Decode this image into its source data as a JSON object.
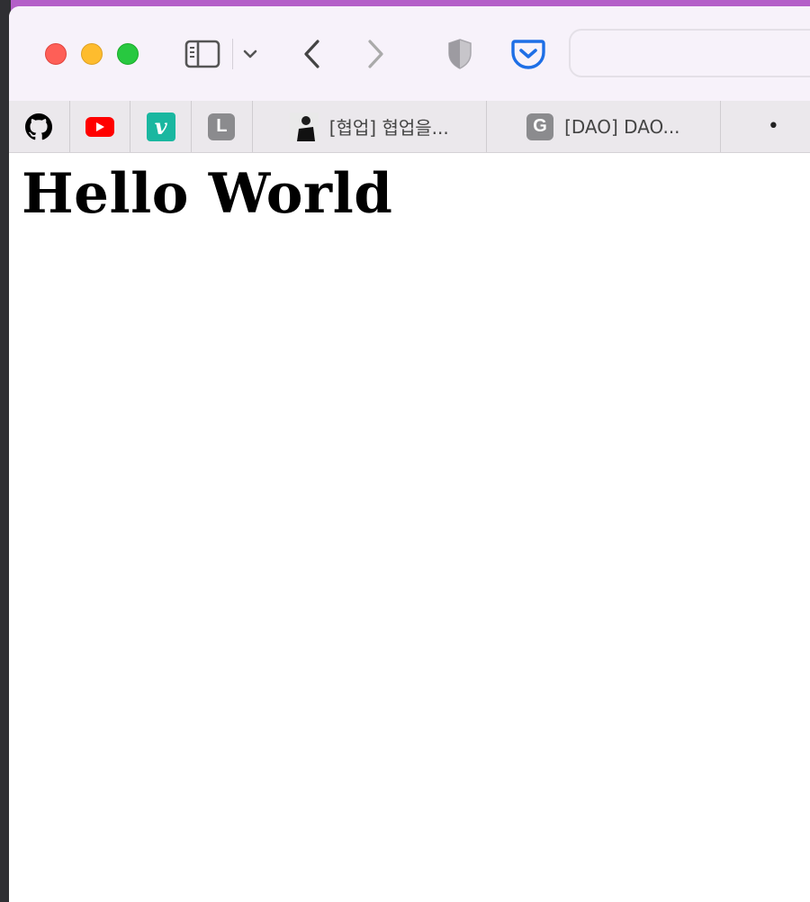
{
  "toolbar": {
    "icons": [
      "sidebar-icon",
      "chevron-down-icon",
      "back-arrow-icon",
      "forward-arrow-icon",
      "shield-icon",
      "pocket-icon"
    ],
    "address_value": ""
  },
  "pinned_tabs": [
    {
      "icon": "github-icon"
    },
    {
      "icon": "youtube-icon"
    },
    {
      "icon": "vimeo-icon",
      "glyph": "v"
    },
    {
      "icon": "letter-l-icon",
      "glyph": "L"
    }
  ],
  "tabs": [
    {
      "title": "[협업] 협업을...",
      "icon": "thumbnail-icon"
    },
    {
      "title": "[DAO] DAO...",
      "icon": "letter-g-icon",
      "glyph": "G"
    }
  ],
  "tab_overflow": "•",
  "page": {
    "heading": "Hello World"
  },
  "colors": {
    "close": "#fe5f57",
    "minimize": "#febc2e",
    "maximize": "#28c840",
    "accent_pocket": "#1e6fe6",
    "wallpaper": "#b45fc8"
  }
}
